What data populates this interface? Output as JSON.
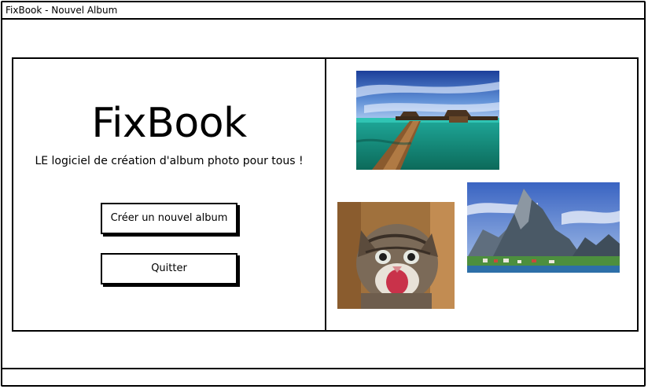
{
  "window": {
    "title": "FixBook - Nouvel Album"
  },
  "home": {
    "app_name": "FixBook",
    "tagline": "LE logiciel de création d'album photo pour tous !",
    "buttons": {
      "new_album": "Créer un nouvel album",
      "quit": "Quitter"
    }
  },
  "gallery": {
    "photos": [
      {
        "subject": "tropical-beach-pier"
      },
      {
        "subject": "kitten"
      },
      {
        "subject": "mountain-village"
      }
    ]
  }
}
